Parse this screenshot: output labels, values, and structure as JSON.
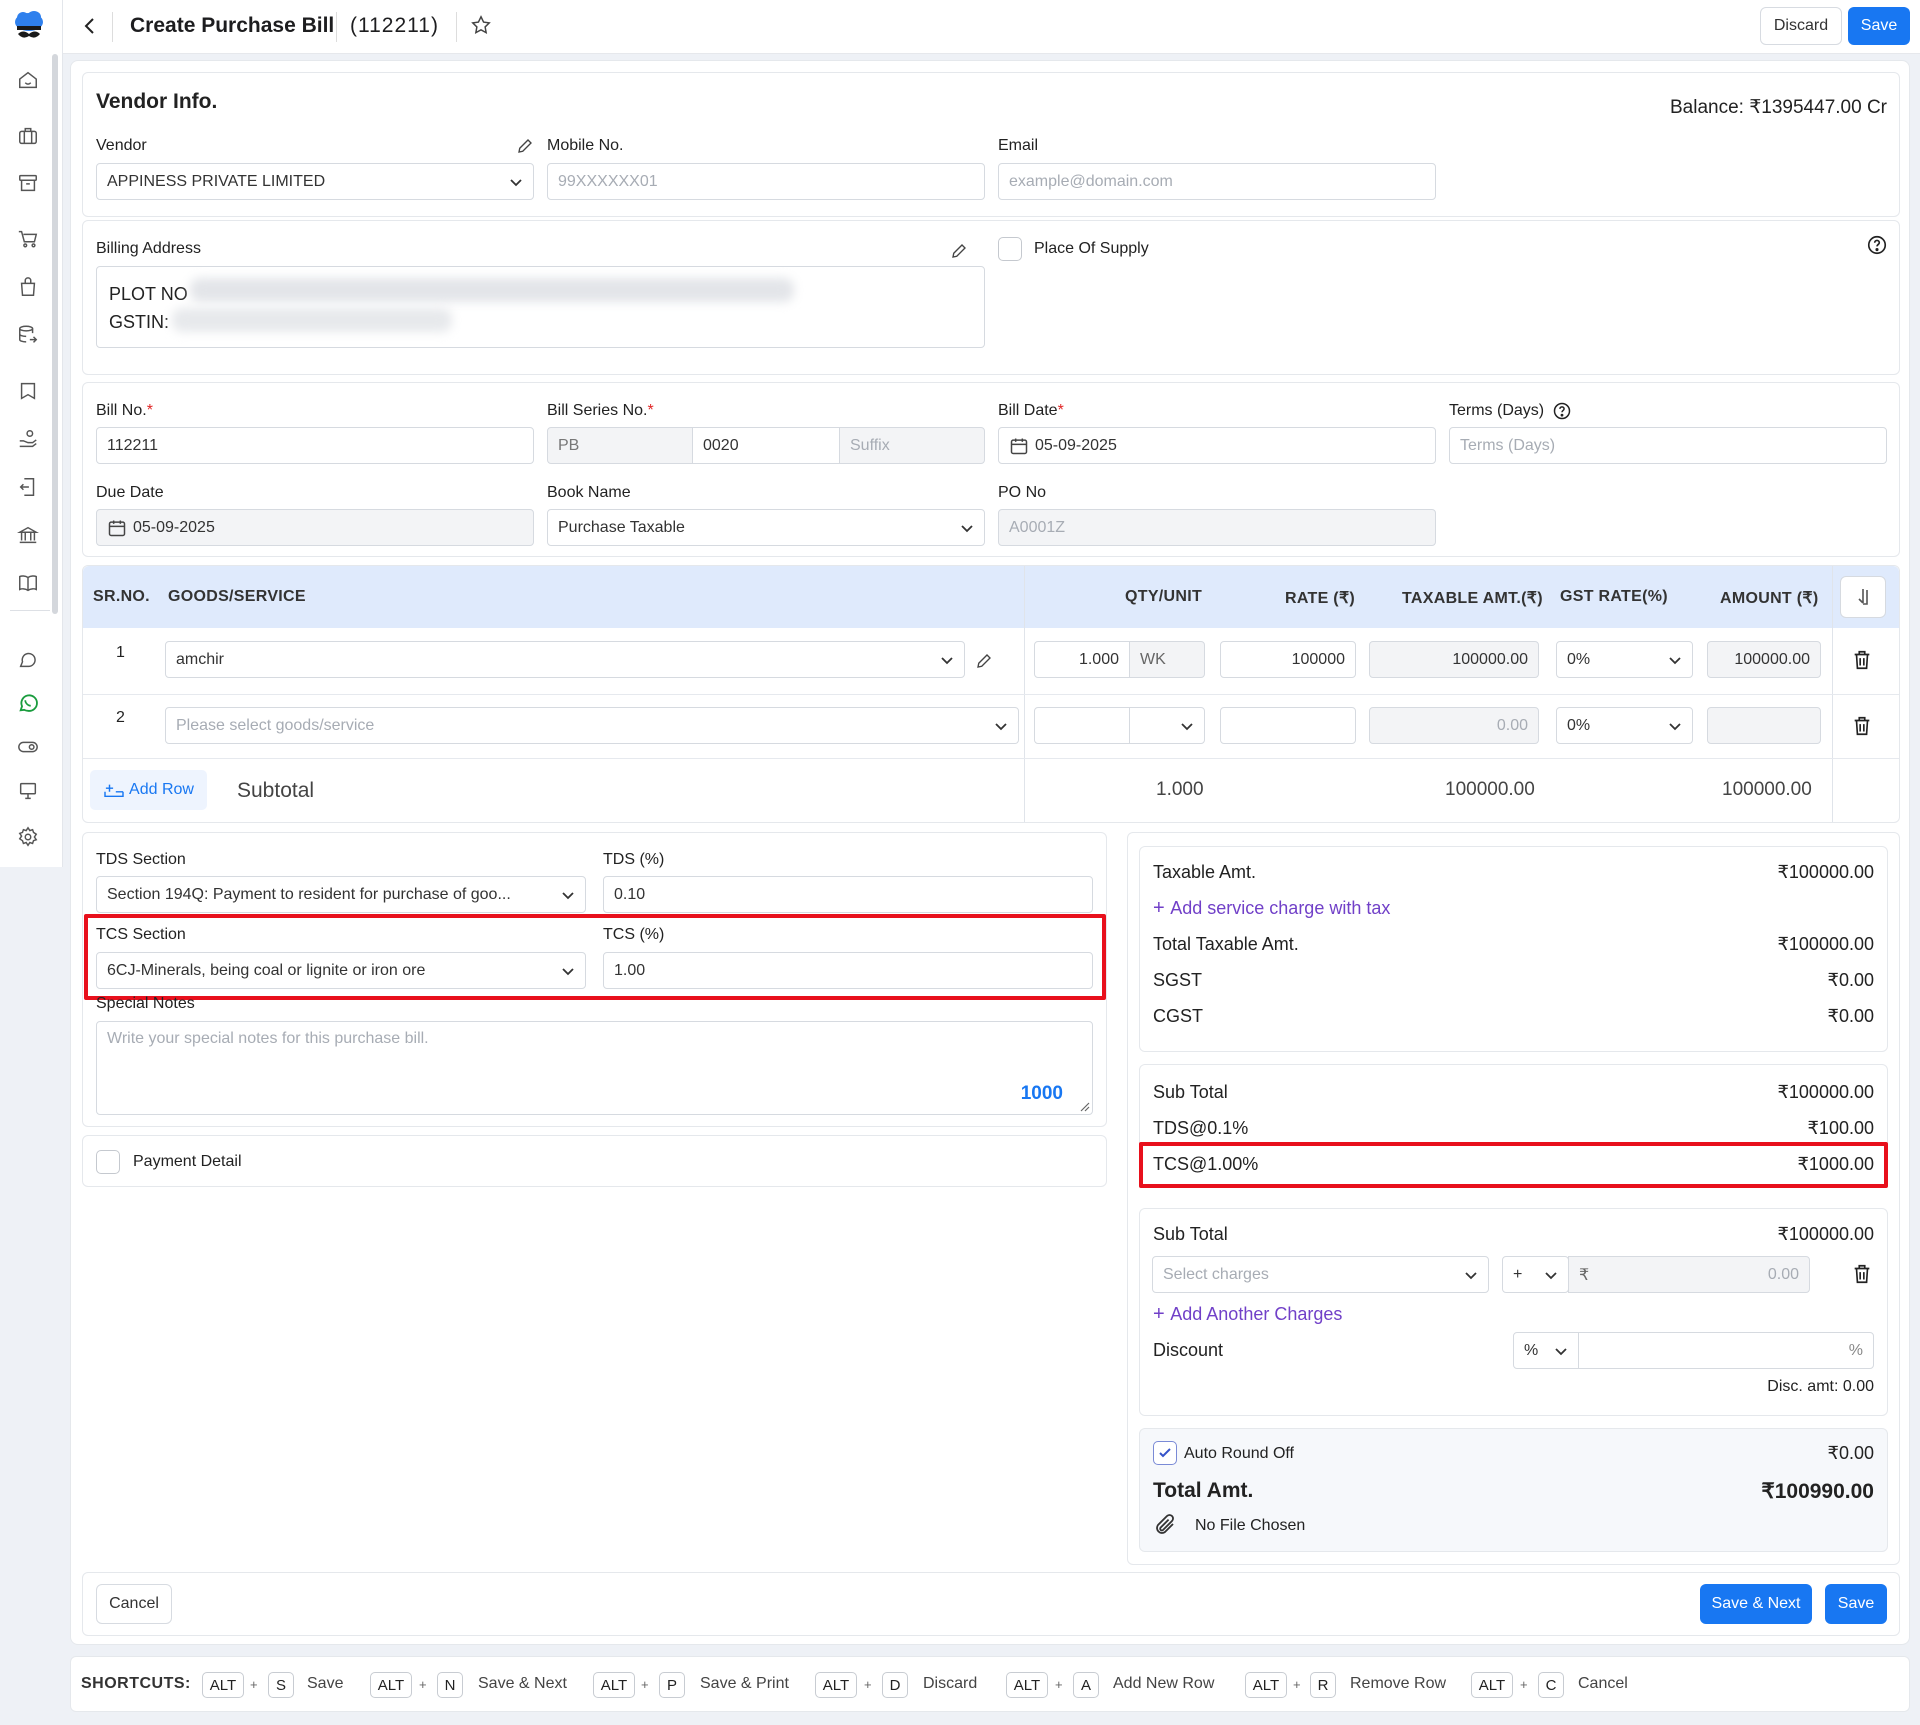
{
  "header": {
    "title": "Create Purchase Bill",
    "bill_ref": "(112211)",
    "discard": "Discard",
    "save": "Save"
  },
  "vendor_info": {
    "heading": "Vendor Info.",
    "balance": "Balance: ₹1395447.00 Cr",
    "vendor_label": "Vendor",
    "vendor_value": "APPINESS PRIVATE LIMITED",
    "mobile_label": "Mobile No.",
    "mobile_placeholder": "99XXXXXX01",
    "email_label": "Email",
    "email_placeholder": "example@domain.com"
  },
  "billing": {
    "label": "Billing Address",
    "line1": "PLOT NO",
    "line2": "GSTIN:",
    "place_of_supply": "Place Of Supply"
  },
  "bill": {
    "bill_no_label": "Bill No.",
    "bill_no": "112211",
    "series_label": "Bill Series No.",
    "series_prefix": "PB",
    "series_number": "0020",
    "series_suffix_placeholder": "Suffix",
    "date_label": "Bill Date",
    "date": "05-09-2025",
    "terms_label": "Terms (Days)",
    "terms_placeholder": "Terms (Days)",
    "due_label": "Due Date",
    "due_date": "05-09-2025",
    "book_label": "Book Name",
    "book_value": "Purchase Taxable",
    "po_label": "PO No",
    "po_placeholder": "A0001Z"
  },
  "items": {
    "headers": [
      "SR.NO.",
      "GOODS/SERVICE",
      "QTY/UNIT",
      "RATE (₹)",
      "TAXABLE AMT.(₹)",
      "GST RATE(%)",
      "AMOUNT (₹)"
    ],
    "rows": [
      {
        "sr": "1",
        "goods": "amchir",
        "qty": "1.000",
        "unit": "WK",
        "rate": "100000",
        "taxable": "100000.00",
        "gst": "0%",
        "amount": "100000.00"
      },
      {
        "sr": "2",
        "goods_placeholder": "Please select goods/service",
        "taxable": "0.00",
        "gst": "0%"
      }
    ],
    "add_row": "Add Row",
    "subtotal_label": "Subtotal",
    "subtotal_qty": "1.000",
    "subtotal_taxable": "100000.00",
    "subtotal_amount": "100000.00"
  },
  "tax": {
    "tds_section_label": "TDS Section",
    "tds_section_value": "Section 194Q: Payment to resident for purchase of goo...",
    "tds_pct_label": "TDS (%)",
    "tds_pct": "0.10",
    "tcs_section_label": "TCS Section",
    "tcs_section_value": "6CJ-Minerals, being coal or lignite or iron ore",
    "tcs_pct_label": "TCS (%)",
    "tcs_pct": "1.00",
    "notes_label": "Special Notes",
    "notes_placeholder": "Write your special notes for this purchase bill.",
    "notes_counter": "1000",
    "payment_detail": "Payment Detail"
  },
  "summary": {
    "taxable_label": "Taxable Amt.",
    "taxable_value": "₹100000.00",
    "add_service": "Add service charge with tax",
    "total_taxable_label": "Total Taxable Amt.",
    "total_taxable_value": "₹100000.00",
    "sgst_label": "SGST",
    "sgst_value": "₹0.00",
    "cgst_label": "CGST",
    "cgst_value": "₹0.00",
    "subtotal1_label": "Sub Total",
    "subtotal1_value": "₹100000.00",
    "tds_label": "TDS@0.1%",
    "tds_value": "₹100.00",
    "tcs_label": "TCS@1.00%",
    "tcs_value": "₹1000.00",
    "subtotal2_label": "Sub Total",
    "subtotal2_value": "₹100000.00",
    "charges_placeholder": "Select charges",
    "charges_sign": "+",
    "rupee": "₹",
    "charges_amount": "0.00",
    "add_charges": "Add Another Charges",
    "discount_label": "Discount",
    "discount_type": "%",
    "discount_suffix": "%",
    "disc_amt": "Disc. amt: 0.00",
    "round_off_label": "Auto Round Off",
    "round_off_value": "₹0.00",
    "total_label": "Total Amt.",
    "total_value": "₹100990.00",
    "no_file": "No File Chosen"
  },
  "footer": {
    "cancel": "Cancel",
    "save_next": "Save & Next",
    "save": "Save"
  },
  "shortcuts": {
    "label": "SHORTCUTS:",
    "alt": "ALT",
    "items": [
      {
        "key": "S",
        "action": "Save"
      },
      {
        "key": "N",
        "action": "Save & Next"
      },
      {
        "key": "P",
        "action": "Save & Print"
      },
      {
        "key": "D",
        "action": "Discard"
      },
      {
        "key": "A",
        "action": "Add New Row"
      },
      {
        "key": "R",
        "action": "Remove Row"
      },
      {
        "key": "C",
        "action": "Cancel"
      }
    ]
  },
  "colors": {
    "accent": "#1877f2",
    "highlight": "#e8101c",
    "link": "#7140c8",
    "table_header": "#dfeafc"
  }
}
